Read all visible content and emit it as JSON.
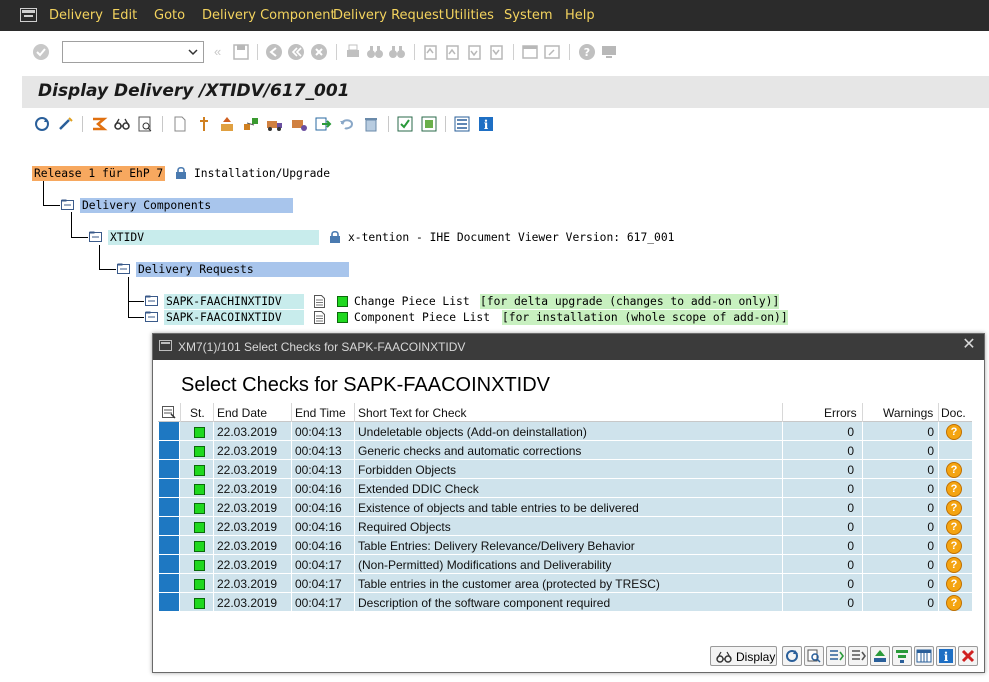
{
  "menu": {
    "items": [
      {
        "label": "Delivery",
        "key": "D"
      },
      {
        "label": "Edit",
        "key": "E"
      },
      {
        "label": "Goto",
        "key": "G"
      },
      {
        "label": "Delivery Component",
        "key": "l"
      },
      {
        "label": "Delivery Request",
        "key": "R"
      },
      {
        "label": "Utilities",
        "key": "U"
      },
      {
        "label": "System",
        "key": "S"
      },
      {
        "label": "Help",
        "key": "H"
      }
    ]
  },
  "command_field": {
    "value": ""
  },
  "page": {
    "title": "Display Delivery /XTIDV/617_001"
  },
  "tree": {
    "root": {
      "label": "Release 1 für EhP 7",
      "status": "Installation/Upgrade"
    },
    "components_folder": {
      "label": "Delivery Components"
    },
    "component": {
      "label": "XTIDV",
      "description": "x-tention - IHE Document Viewer Version: 617_001"
    },
    "requests_folder": {
      "label": "Delivery Requests"
    },
    "requests": [
      {
        "label": "SAPK-FAACHINXTIDV",
        "type": "Change Piece List",
        "note": "[for delta upgrade (changes to add-on only)]"
      },
      {
        "label": "SAPK-FAACOINXTIDV",
        "type": "Component Piece List",
        "note": "[for installation (whole scope of add-on)]"
      }
    ]
  },
  "popup": {
    "window_title": "XM7(1)/101 Select Checks for SAPK-FAACOINXTIDV",
    "heading": "Select Checks for SAPK-FAACOINXTIDV",
    "columns": {
      "status": "St.",
      "end_date": "End Date",
      "end_time": "End Time",
      "short_text": "Short Text for Check",
      "errors": "Errors",
      "warnings": "Warnings",
      "doc": "Doc."
    },
    "rows": [
      {
        "end_date": "22.03.2019",
        "end_time": "00:04:13",
        "text": "Undeletable objects (Add-on deinstallation)",
        "errors": "0",
        "warnings": "0",
        "doc": true
      },
      {
        "end_date": "22.03.2019",
        "end_time": "00:04:13",
        "text": "Generic checks and automatic corrections",
        "errors": "0",
        "warnings": "0",
        "doc": false
      },
      {
        "end_date": "22.03.2019",
        "end_time": "00:04:13",
        "text": "Forbidden Objects",
        "errors": "0",
        "warnings": "0",
        "doc": true
      },
      {
        "end_date": "22.03.2019",
        "end_time": "00:04:16",
        "text": "Extended DDIC Check",
        "errors": "0",
        "warnings": "0",
        "doc": true
      },
      {
        "end_date": "22.03.2019",
        "end_time": "00:04:16",
        "text": "Existence of objects and table entries to be delivered",
        "errors": "0",
        "warnings": "0",
        "doc": true
      },
      {
        "end_date": "22.03.2019",
        "end_time": "00:04:16",
        "text": "Required Objects",
        "errors": "0",
        "warnings": "0",
        "doc": true
      },
      {
        "end_date": "22.03.2019",
        "end_time": "00:04:16",
        "text": "Table Entries: Delivery Relevance/Delivery Behavior",
        "errors": "0",
        "warnings": "0",
        "doc": true
      },
      {
        "end_date": "22.03.2019",
        "end_time": "00:04:17",
        "text": "(Non-Permitted) Modifications and Deliverability",
        "errors": "0",
        "warnings": "0",
        "doc": true
      },
      {
        "end_date": "22.03.2019",
        "end_time": "00:04:17",
        "text": "Table entries in the customer area (protected by TRESC)",
        "errors": "0",
        "warnings": "0",
        "doc": true
      },
      {
        "end_date": "22.03.2019",
        "end_time": "00:04:17",
        "text": "Description of the software component required",
        "errors": "0",
        "warnings": "0",
        "doc": true
      }
    ],
    "footer": {
      "display_label": "Display"
    }
  },
  "colors": {
    "menubar_bg": "#2b2b2b",
    "menu_text": "#f3d35e",
    "root_highlight": "#f7a85f",
    "folder_highlight": "#a8c5ec",
    "component_highlight": "#c8ecec",
    "note_highlight": "#c8f0c0",
    "row_band": "#cfe3ec",
    "row_selector": "#1e78c2",
    "status_green": "#1fd81f",
    "doc_icon": "#f4a411"
  }
}
